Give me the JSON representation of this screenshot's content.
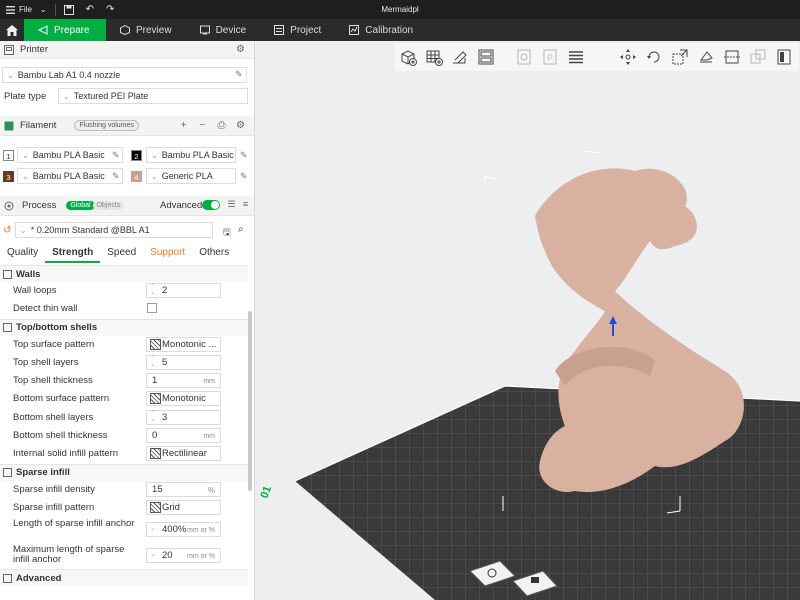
{
  "titlebar": {
    "file_label": "File",
    "window_title": "Mermaidpl"
  },
  "tabs": [
    {
      "label": "Prepare"
    },
    {
      "label": "Preview"
    },
    {
      "label": "Device"
    },
    {
      "label": "Project"
    },
    {
      "label": "Calibration"
    }
  ],
  "printer": {
    "section_label": "Printer",
    "printer_name": "Bambu Lab A1 0.4 nozzle",
    "plate_type_label": "Plate type",
    "plate_type_value": "Textured PEI Plate"
  },
  "filament": {
    "section_label": "Filament",
    "flushing_label": "Flushing volumes",
    "slots": [
      {
        "num": "1",
        "name": "Bambu PLA Basic",
        "color": "#ffffff",
        "num_color": "#333333"
      },
      {
        "num": "2",
        "name": "Bambu PLA Basic",
        "color": "#000000",
        "num_color": "#ffffff"
      },
      {
        "num": "3",
        "name": "Bambu PLA Basic",
        "color": "#6b3a22",
        "num_color": "#ffffff"
      },
      {
        "num": "4",
        "name": "Generic PLA",
        "color": "#c9a08c",
        "num_color": "#ffffff"
      }
    ]
  },
  "process": {
    "section_label": "Process",
    "global_label": "Global",
    "objects_label": "Objects",
    "advanced_label": "Advanced",
    "preset": "* 0.20mm Standard @BBL A1"
  },
  "subtabs": [
    "Quality",
    "Strength",
    "Speed",
    "Support",
    "Others"
  ],
  "settings": {
    "walls": {
      "title": "Walls",
      "wall_loops_label": "Wall loops",
      "wall_loops": "2",
      "detect_thin_wall_label": "Detect thin wall"
    },
    "top_bottom": {
      "title": "Top/bottom shells",
      "top_pattern_label": "Top surface pattern",
      "top_pattern": "Monotonic ...",
      "top_layers_label": "Top shell layers",
      "top_layers": "5",
      "top_thickness_label": "Top shell thickness",
      "top_thickness": "1",
      "bottom_pattern_label": "Bottom surface pattern",
      "bottom_pattern": "Monotonic",
      "bottom_layers_label": "Bottom shell layers",
      "bottom_layers": "3",
      "bottom_thickness_label": "Bottom shell thickness",
      "bottom_thickness": "0",
      "internal_pattern_label": "Internal solid infill pattern",
      "internal_pattern": "Rectilinear",
      "unit_mm": "mm"
    },
    "sparse": {
      "title": "Sparse infill",
      "density_label": "Sparse infill density",
      "density": "15",
      "density_unit": "%",
      "pattern_label": "Sparse infill pattern",
      "pattern": "Grid",
      "anchor_label": "Length of sparse infill anchor",
      "anchor": "400%",
      "anchor_unit": "mm or %",
      "max_anchor_label": "Maximum length of sparse infill anchor",
      "max_anchor": "20",
      "max_anchor_unit": "mm or %"
    },
    "advanced_title": "Advanced"
  },
  "plate_label": "01",
  "colors": {
    "accent": "#00ae42",
    "model": "#d9b1a0",
    "plate": "#3a3a3a"
  }
}
